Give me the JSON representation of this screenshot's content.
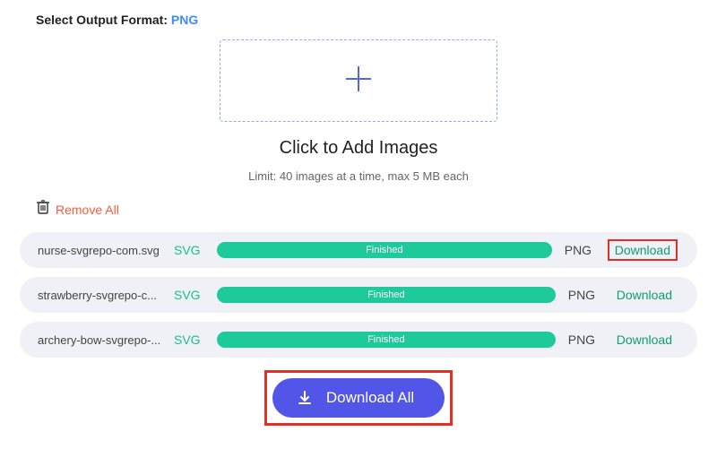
{
  "format": {
    "label": "Select Output Format:",
    "value": "PNG"
  },
  "dropzone": {
    "title": "Click to Add Images",
    "limit": "Limit: 40 images at a time, max 5 MB each"
  },
  "actions": {
    "remove_all": "Remove All",
    "download_all": "Download All",
    "download": "Download"
  },
  "files": [
    {
      "name": "nurse-svgrepo-com.svg",
      "input_format": "SVG",
      "status": "Finished",
      "output_format": "PNG",
      "highlight": true
    },
    {
      "name": "strawberry-svgrepo-c...",
      "input_format": "SVG",
      "status": "Finished",
      "output_format": "PNG",
      "highlight": false
    },
    {
      "name": "archery-bow-svgrepo-...",
      "input_format": "SVG",
      "status": "Finished",
      "output_format": "PNG",
      "highlight": false
    }
  ],
  "colors": {
    "accent_blue": "#5156e8",
    "accent_green": "#1ec99a",
    "accent_orange": "#ff5a3c",
    "highlight_red": "#e33027"
  }
}
